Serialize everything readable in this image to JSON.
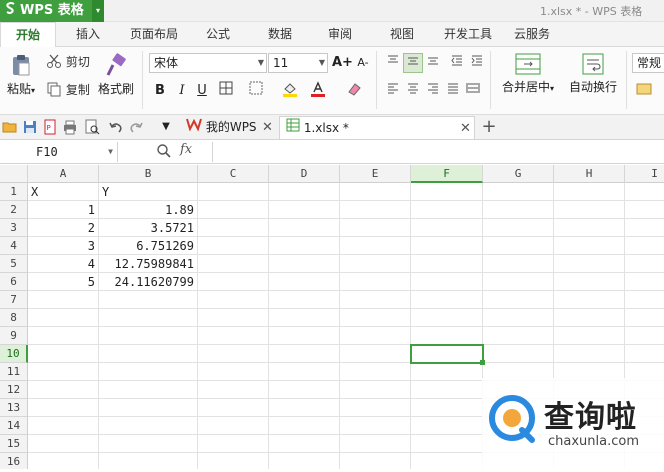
{
  "app": {
    "name": "WPS 表格",
    "window_title": "1.xlsx * - WPS 表格"
  },
  "menu": {
    "tabs": [
      "开始",
      "插入",
      "页面布局",
      "公式",
      "数据",
      "审阅",
      "视图",
      "开发工具",
      "云服务"
    ],
    "active": "开始"
  },
  "ribbon": {
    "paste": "粘贴",
    "cut": "剪切",
    "copy": "复制",
    "format_painter": "格式刷",
    "font_name": "宋体",
    "font_size": "11",
    "bold": "B",
    "italic": "I",
    "underline": "U",
    "grow_font": "A+",
    "shrink_font": "A-",
    "merge_center": "合并居中",
    "auto_wrap": "自动换行",
    "number_format": "常规",
    "accent_color": "#3f9f3f"
  },
  "doc_tabs": [
    {
      "label": "我的WPS",
      "active": false
    },
    {
      "label": "1.xlsx *",
      "active": true
    }
  ],
  "formula_bar": {
    "cell_ref": "F10",
    "fx": "fx",
    "value": ""
  },
  "sheet": {
    "columns": [
      "A",
      "B",
      "C",
      "D",
      "E",
      "F",
      "G",
      "H",
      "I"
    ],
    "rows": [
      "1",
      "2",
      "3",
      "4",
      "5",
      "6",
      "7",
      "8",
      "9",
      "10",
      "11",
      "12",
      "13",
      "14",
      "15",
      "16"
    ],
    "selected_cell": "F10",
    "cells": {
      "A1": "X",
      "B1": "Y",
      "A2": "1",
      "B2": "1.89",
      "A3": "2",
      "B3": "3.5721",
      "A4": "3",
      "B4": "6.751269",
      "A5": "4",
      "B5": "12.75989841",
      "A6": "5",
      "B6": "24.11620799"
    }
  },
  "watermark": {
    "brand": "查询啦",
    "site": "chaxunla.com"
  }
}
